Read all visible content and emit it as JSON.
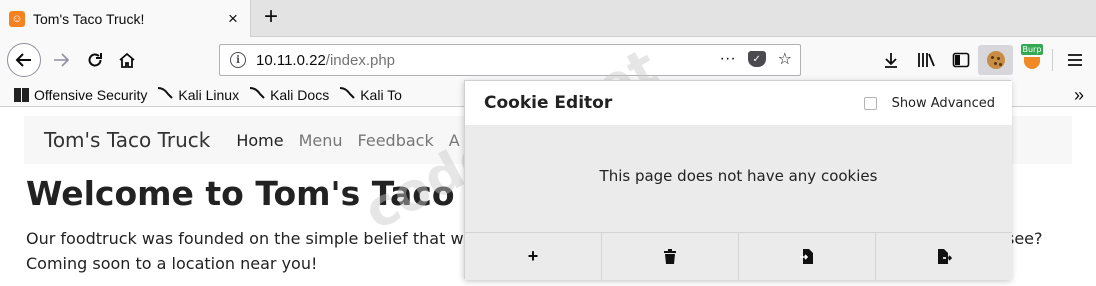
{
  "browser": {
    "tab_title": "Tom's Taco Truck!",
    "tab_close": "×",
    "new_tab": "+",
    "url_host": "10.11.0.22",
    "url_path": "/index.php",
    "url_more": "···",
    "bookmarks": [
      {
        "label": "Offensive Security",
        "icon": "offsec-icon"
      },
      {
        "label": "Kali Linux",
        "icon": "kali-icon"
      },
      {
        "label": "Kali Docs",
        "icon": "kali-icon"
      },
      {
        "label": "Kali To",
        "icon": "kali-icon"
      }
    ],
    "bookmarks_more": "»",
    "burp_badge": "Burp"
  },
  "site": {
    "brand": "Tom's Taco Truck",
    "nav": [
      "Home",
      "Menu",
      "Feedback",
      "A"
    ],
    "heading": "Welcome to Tom's Taco Truc",
    "para_line1": "Our foodtruck was founded on the simple belief that we m",
    "para_line1_end": "see?",
    "para_line2": "Coming soon to a location near you!"
  },
  "cookie_editor": {
    "title": "Cookie Editor",
    "show_advanced": "Show Advanced",
    "empty_message": "This page does not have any cookies",
    "actions": [
      {
        "name": "add",
        "glyph": "+"
      },
      {
        "name": "delete-all",
        "glyph": "🗑"
      },
      {
        "name": "import",
        "glyph": "⭫"
      },
      {
        "name": "export",
        "glyph": "⭬"
      }
    ]
  },
  "watermark": "codeby.net"
}
